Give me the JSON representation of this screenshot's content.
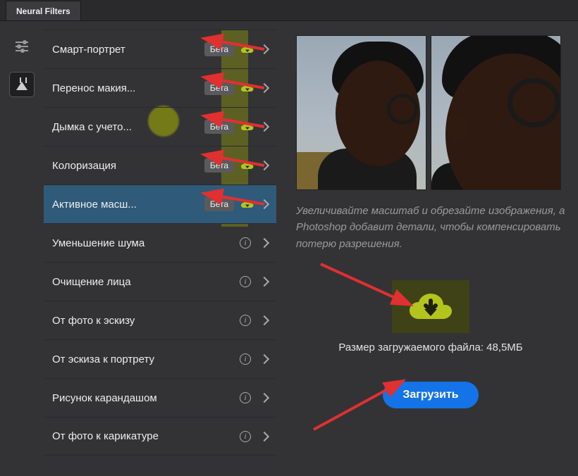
{
  "tab_title": "Neural Filters",
  "filters": [
    {
      "label": "Смарт-портрет",
      "badge": "Бета",
      "has_dl": true
    },
    {
      "label": "Перенос макия...",
      "badge": "Бета",
      "has_dl": true
    },
    {
      "label": "Дымка с учето...",
      "badge": "Бета",
      "has_dl": true
    },
    {
      "label": "Колоризация",
      "badge": "Бета",
      "has_dl": true
    },
    {
      "label": "Активное масш...",
      "badge": "Бета",
      "has_dl": true,
      "selected": true
    },
    {
      "label": "Уменьшение шума",
      "info": true
    },
    {
      "label": "Очищение лица",
      "info": true
    },
    {
      "label": "От фото к эскизу",
      "info": true
    },
    {
      "label": "От эскиза к портрету",
      "info": true
    },
    {
      "label": "Рисунок карандашом",
      "info": true
    },
    {
      "label": "От фото к карикатуре",
      "info": true
    }
  ],
  "description": "Увеличивайте масштаб и обрезайте изображения, а Photoshop добавит детали, чтобы компенсировать потерю разрешения.",
  "file_size_label": "Размер загружаемого файла: 48,5МБ",
  "download_button": "Загрузить",
  "info_glyph": "i",
  "colors": {
    "accent": "#1473e6",
    "cloud": "#b3c41f"
  }
}
